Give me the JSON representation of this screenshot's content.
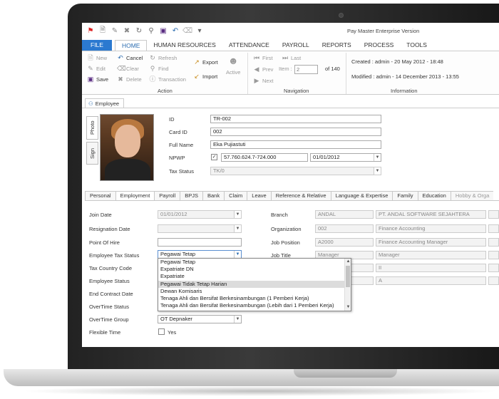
{
  "app_title": "Pay Master Enterprise Version",
  "menu": {
    "file": "FILE",
    "tabs": [
      "HOME",
      "HUMAN RESOURCES",
      "ATTENDANCE",
      "PAYROLL",
      "REPORTS",
      "PROCESS",
      "TOOLS"
    ],
    "active": "HOME"
  },
  "ribbon": {
    "action": {
      "label": "Action",
      "new": "New",
      "cancel": "Cancel",
      "refresh": "Refresh",
      "edit": "Edit",
      "clear": "Clear",
      "find": "Find",
      "save": "Save",
      "delete": "Delete",
      "transaction": "Transaction",
      "export": "Export",
      "import": "Import",
      "active": "Active"
    },
    "navigation": {
      "label": "Navigation",
      "first": "First",
      "last": "Last",
      "prev": "Prev",
      "next": "Next",
      "item_label": "Item :",
      "item_value": "2",
      "of": "of 140"
    },
    "information": {
      "label": "Information",
      "created": "Created : admin - 20 May 2012 - 18:48",
      "modified": "Modified : admin - 14 December 2013 - 13:55"
    }
  },
  "doc_tab": "Employee",
  "side_tabs": {
    "photo": "Photo",
    "sign": "Sign"
  },
  "header_fields": {
    "id_label": "ID",
    "id_value": "TR-002",
    "card_label": "Card ID",
    "card_value": "002",
    "name_label": "Full Name",
    "name_value": "Eka Pujiastuti",
    "npwp_label": "NPWP",
    "npwp_value": "57.760.624.7-724.000",
    "npwp_date": "01/01/2012",
    "tax_label": "Tax Status",
    "tax_value": "TK/0"
  },
  "sub_tabs": [
    "Personal",
    "Employment",
    "Payroll",
    "BPJS",
    "Bank",
    "Claim",
    "Leave",
    "Reference & Relative",
    "Language & Expertise",
    "Family",
    "Education",
    "Hobby & Orga"
  ],
  "active_sub_tab": "Employment",
  "employment": {
    "join_date_label": "Join Date",
    "join_date": "01/01/2012",
    "resignation_label": "Resignation Date",
    "poh_label": "Point Of Hire",
    "tax_status_label": "Employee Tax Status",
    "tax_status": "Pegawai Tetap",
    "tax_country_label": "Tax Country Code",
    "emp_status_label": "Employee Status",
    "end_contract_label": "End Contract Date",
    "overtime_status_label": "OverTime Status",
    "overtime_group_label": "OverTime Group",
    "overtime_group": "OT Depnaker",
    "flexible_label": "Flexible Time",
    "flexible_value": "Yes",
    "branch_label": "Branch",
    "branch_code": "ANDAL",
    "branch_name": "PT. ANDAL SOFTWARE SEJAHTERA",
    "org_label": "Organization",
    "org_code": "002",
    "org_name": "Finance Accounting",
    "pos_label": "Job Position",
    "pos_code": "A2000",
    "pos_name": "Finance Accounting Manager",
    "title_label": "Job Title",
    "title_code": "Manager",
    "title_name": "Manager",
    "grade_value": "II",
    "level_value": "A"
  },
  "dropdown_options": [
    "Pegawai Tetap",
    "Expatriate DN",
    "Expatriate",
    "Pegawai Tidak Tetap Harian",
    "Dewan Komisaris",
    "Tenaga Ahli dan Bersifat Berkesinambungan (1 Pemberi Kerja)",
    "Tenaga Ahli dan Bersifat Berkesinambungan (Lebih dari 1 Pemberi Kerja)"
  ],
  "dropdown_selected": 3
}
